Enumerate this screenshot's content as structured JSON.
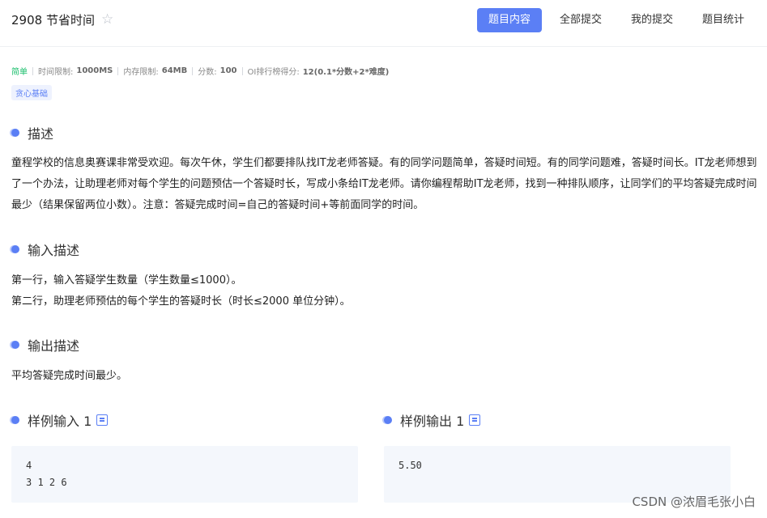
{
  "header": {
    "title": "2908 节省时间",
    "tabs": [
      "题目内容",
      "全部提交",
      "我的提交",
      "题目统计"
    ],
    "active_tab": "题目内容"
  },
  "meta": {
    "difficulty": "简单",
    "time_limit_label": "时间限制:",
    "time_limit": "1000MS",
    "memory_limit_label": "内存限制:",
    "memory_limit": "64MB",
    "score_label": "分数:",
    "score": "100",
    "oi_label": "OI排行榜得分:",
    "oi_formula": "12(0.1*分数+2*难度)",
    "tag": "贪心基础"
  },
  "sections": {
    "description": {
      "heading": "描述",
      "text": "童程学校的信息奥赛课非常受欢迎。每次午休，学生们都要排队找IT龙老师答疑。有的同学问题简单，答疑时间短。有的同学问题难，答疑时间长。IT龙老师想到了一个办法，让助理老师对每个学生的问题预估一个答疑时长，写成小条给IT龙老师。请你编程帮助IT龙老师，找到一种排队顺序，让同学们的平均答疑完成时间最少（结果保留两位小数）。注意：答疑完成时间=自己的答疑时间+等前面同学的时间。"
    },
    "input": {
      "heading": "输入描述",
      "line1": "第一行，输入答疑学生数量（学生数量≤1000）。",
      "line2": "第二行，助理老师预估的每个学生的答疑时长（时长≤2000 单位分钟）。"
    },
    "output": {
      "heading": "输出描述",
      "text": "平均答疑完成时间最少。"
    },
    "sample_input": {
      "heading": "样例输入 1",
      "content": "4\n3 1 2 6"
    },
    "sample_output": {
      "heading": "样例输出 1",
      "content": "5.50"
    }
  },
  "watermark": "CSDN @浓眉毛张小白",
  "colors": {
    "accent": "#5b7ff5",
    "easy": "#19be6b",
    "sample_bg": "#f4f7fc"
  }
}
